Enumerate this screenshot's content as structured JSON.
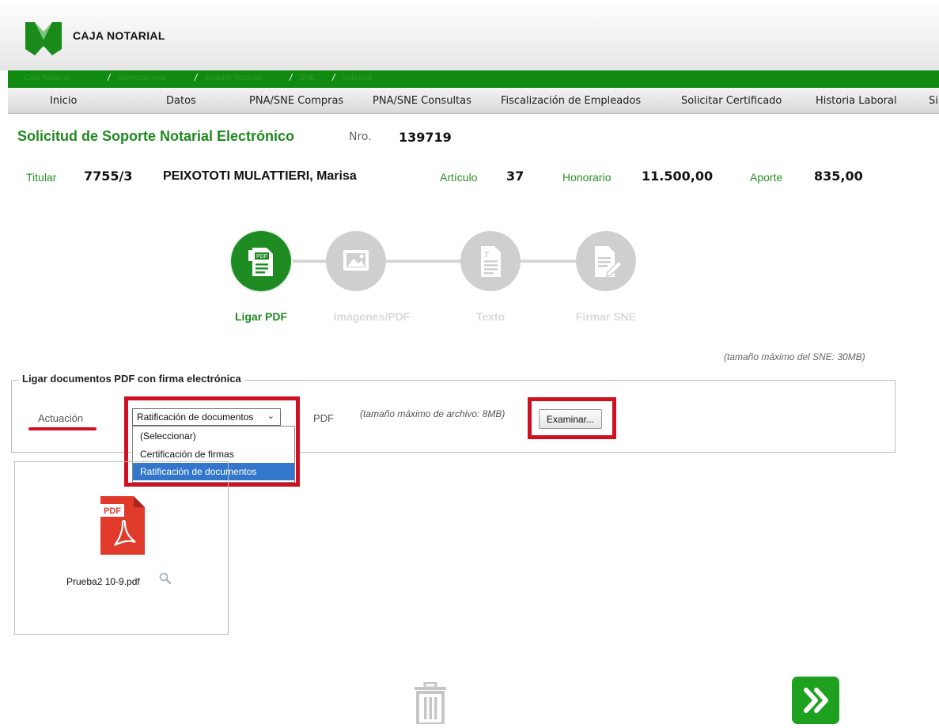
{
  "brand": {
    "name": "CAJA NOTARIAL"
  },
  "breadcrumb": [
    "Caja Notarial",
    "Servicios web",
    "Soporte Notarial",
    "SNE",
    "Solicitud"
  ],
  "menu": [
    "Inicio",
    "Datos",
    "PNA/SNE Compras",
    "PNA/SNE Consultas",
    "Fiscalización de Empleados",
    "Solicitar Certificado",
    "Historia Laboral",
    "Si"
  ],
  "request": {
    "title": "Solicitud de Soporte Notarial Electrónico",
    "nro_label": "Nro.",
    "nro_value": "139719",
    "titular_label": "Titular",
    "titular_code": "7755/3",
    "titular_name": "PEIXOTOTI MULATTIERI, Marisa",
    "articulo_label": "Artículo",
    "articulo_value": "37",
    "honorario_label": "Honorario",
    "honorario_value": "11.500,00",
    "aporte_label": "Aporte",
    "aporte_value": "835,00"
  },
  "steps": [
    {
      "label": "Ligar PDF",
      "icon": "pdf-document-icon",
      "active": true
    },
    {
      "label": "Imágenes/PDF",
      "icon": "image-icon",
      "active": false
    },
    {
      "label": "Texto",
      "icon": "text-document-icon",
      "active": false
    },
    {
      "label": "Firmar SNE",
      "icon": "sign-document-icon",
      "active": false
    }
  ],
  "upload": {
    "max_sne_note": "(tamaño máximo del SNE: 30MB)",
    "legend": "Ligar documentos PDF con firma electrónica",
    "actuacion_label": "Actuación",
    "select_value": "Ratificación de documentos",
    "options": [
      "(Seleccionar)",
      "Certificación de firmas",
      "Ratificación de documentos"
    ],
    "selected_option_index": 2,
    "pdf_label": "PDF",
    "max_file_note": "(tamaño máximo de archivo: 8MB)",
    "browse_button": "Examinar..."
  },
  "file": {
    "name": "Prueba2 10-9.pdf",
    "icon_label": "PDF"
  },
  "colors": {
    "brand_green": "#108a10",
    "accent_green": "#1e8c23",
    "highlight_red": "#d01020",
    "select_blue": "#3377cc"
  }
}
